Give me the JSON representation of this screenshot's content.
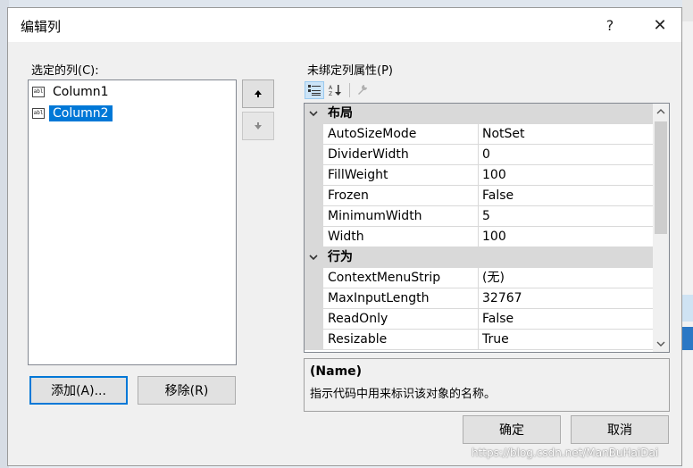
{
  "dialog": {
    "title": "编辑列",
    "help_glyph": "?",
    "close_glyph": "✕"
  },
  "members": {
    "label": "选定的列(C):",
    "items": [
      {
        "text": "Column1",
        "icon_label": "abl",
        "selected": false
      },
      {
        "text": "Column2",
        "icon_label": "abl",
        "selected": true
      }
    ],
    "move_up_icon": "arrow-up-icon",
    "move_down_icon": "arrow-down-icon"
  },
  "buttons": {
    "add": "添加(A)...",
    "remove": "移除(R)",
    "ok": "确定",
    "cancel": "取消"
  },
  "properties": {
    "label": "未绑定列属性(P)",
    "categories": [
      {
        "name": "布局",
        "rows": [
          {
            "name": "AutoSizeMode",
            "value": "NotSet"
          },
          {
            "name": "DividerWidth",
            "value": "0"
          },
          {
            "name": "FillWeight",
            "value": "100"
          },
          {
            "name": "Frozen",
            "value": "False"
          },
          {
            "name": "MinimumWidth",
            "value": "5"
          },
          {
            "name": "Width",
            "value": "100"
          }
        ]
      },
      {
        "name": "行为",
        "rows": [
          {
            "name": "ContextMenuStrip",
            "value": "(无)"
          },
          {
            "name": "MaxInputLength",
            "value": "32767"
          },
          {
            "name": "ReadOnly",
            "value": "False"
          },
          {
            "name": "Resizable",
            "value": "True"
          }
        ]
      }
    ],
    "description_title": "(Name)",
    "description_text": "指示代码中用来标识该对象的名称。"
  },
  "watermark": "https://blog.csdn.net/ManBuHaiDai",
  "colors": {
    "selection": "#0078d7",
    "category_bg": "#d9d9d9",
    "dialog_bg": "#f0f0f0"
  }
}
